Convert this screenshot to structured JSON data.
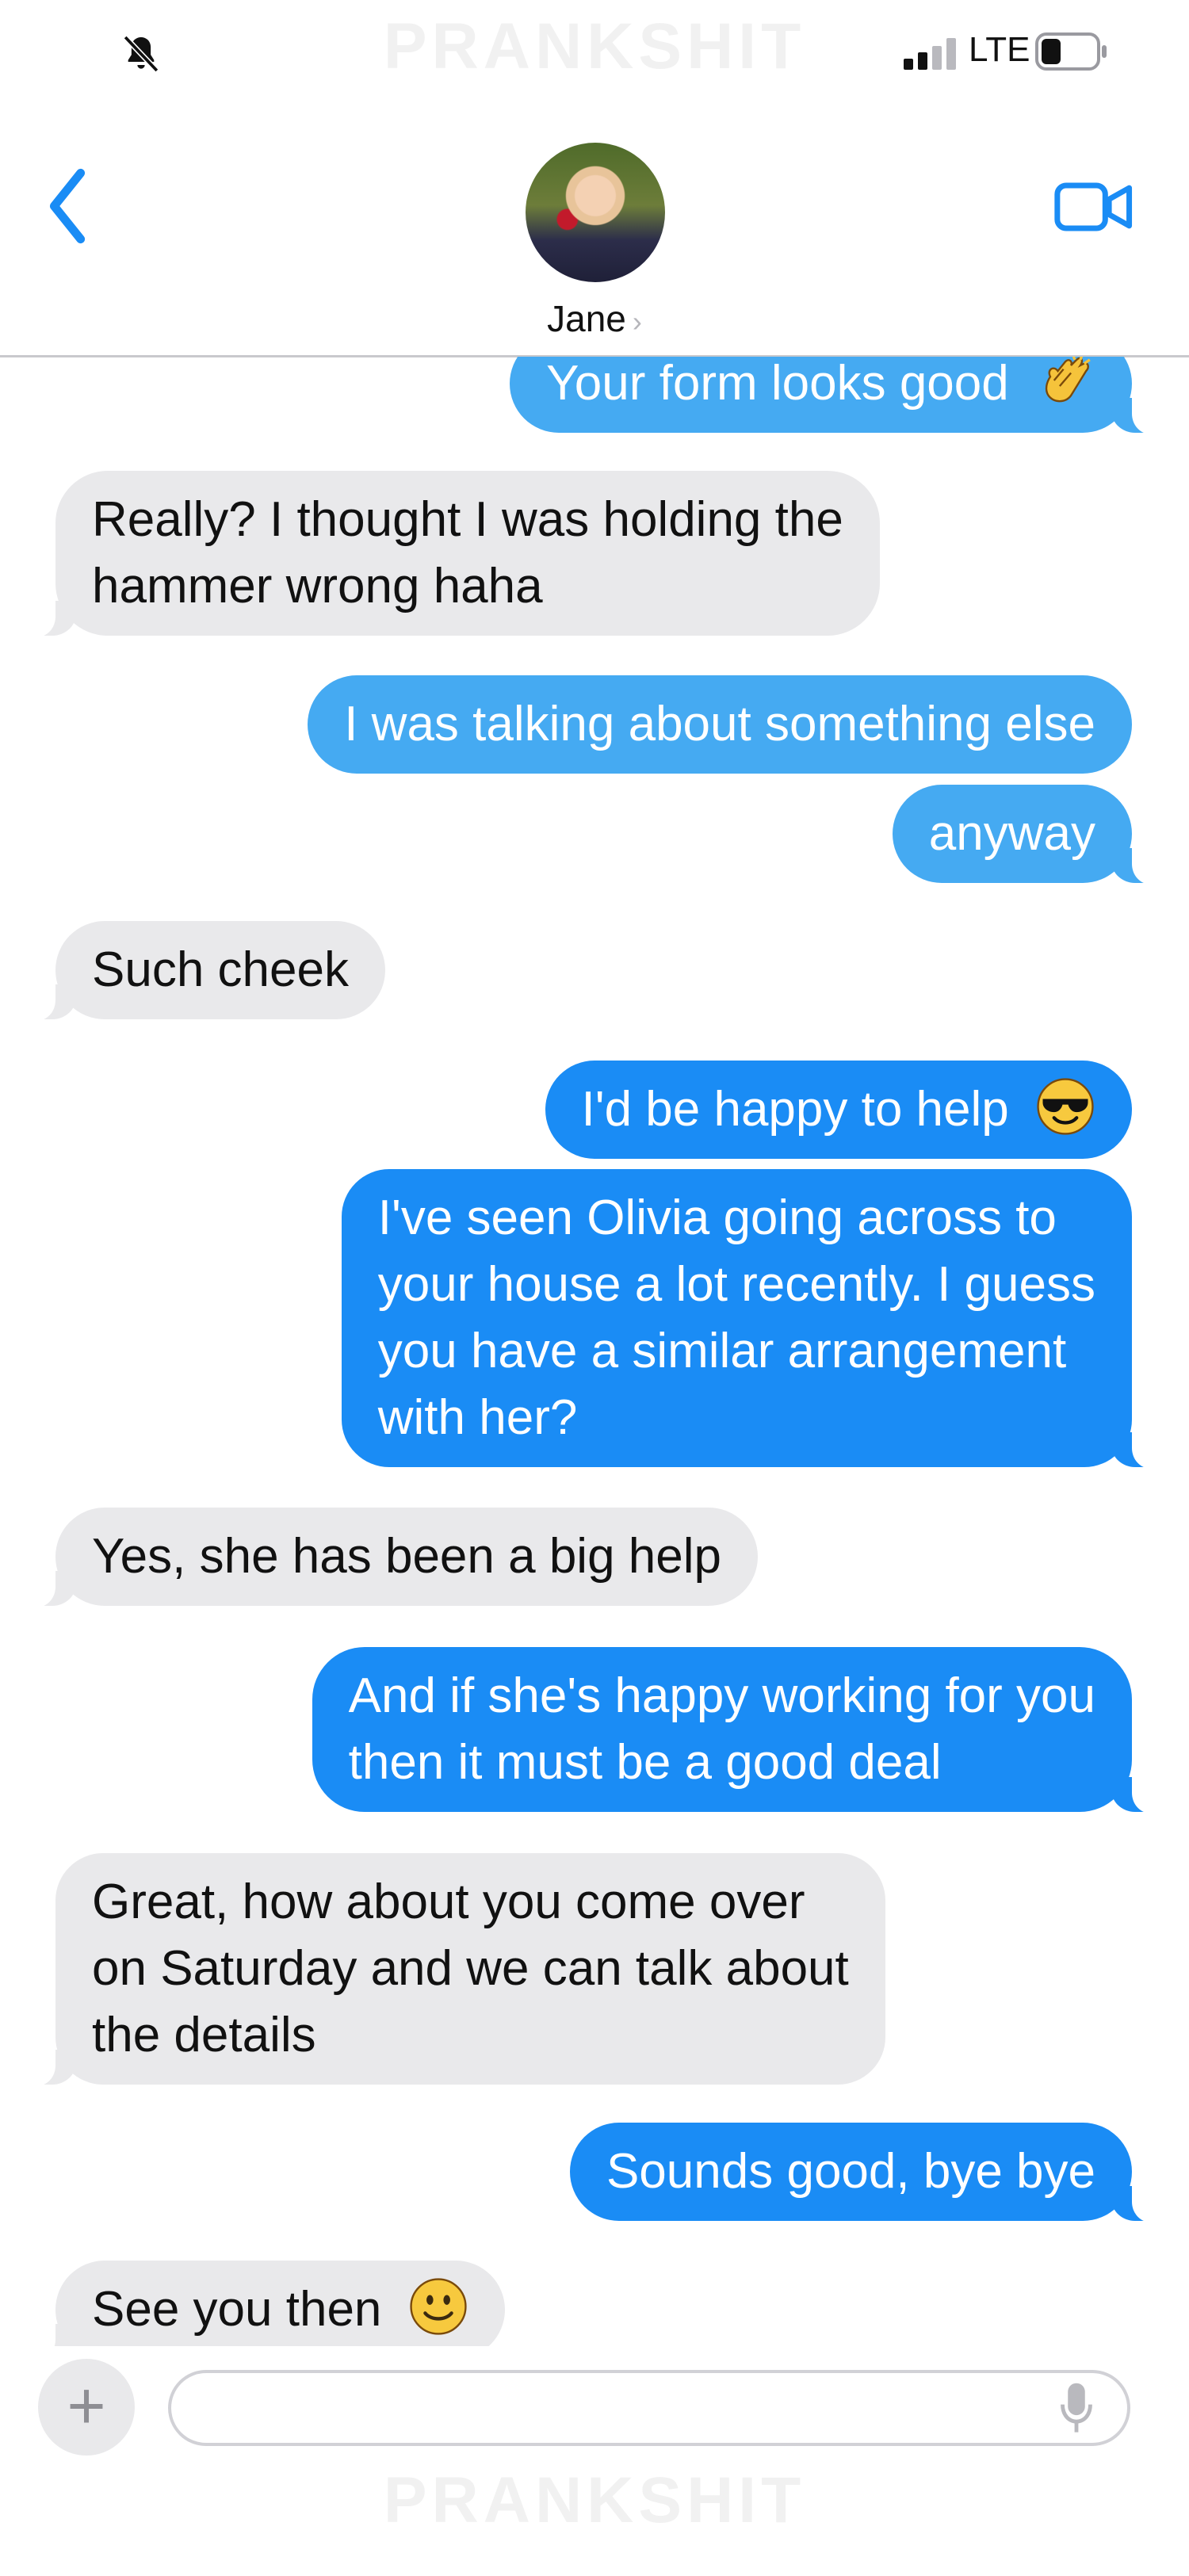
{
  "status_bar": {
    "watermark": "PRANKSHIT",
    "network": "LTE",
    "icons": [
      "bell-slash-icon",
      "signal-icon",
      "battery-icon"
    ]
  },
  "header": {
    "contact_name": "Jane",
    "chevron": "›",
    "icons": [
      "chevron-left-icon",
      "avatar",
      "video-camera-icon"
    ]
  },
  "messages": [
    {
      "side": "out",
      "text": "Your form looks good",
      "emoji": "clapping-hands"
    },
    {
      "side": "in",
      "lines": [
        "Really? I thought I was holding the",
        "hammer wrong haha"
      ]
    },
    {
      "side": "out",
      "text": "I was talking about something else"
    },
    {
      "side": "out",
      "text": "anyway"
    },
    {
      "side": "in",
      "text": "Such cheek"
    },
    {
      "side": "out",
      "text": "I'd be happy to help",
      "emoji": "sunglasses"
    },
    {
      "side": "out",
      "lines": [
        "I've seen Olivia going across to",
        "your house a lot recently. I guess",
        "you have a similar arrangement",
        "with her?"
      ]
    },
    {
      "side": "in",
      "text": "Yes, she has been a big help"
    },
    {
      "side": "out",
      "lines": [
        "And if she's happy working for you",
        "then it must be a good deal"
      ]
    },
    {
      "side": "in",
      "lines": [
        "Great, how about you come over",
        "on Saturday and we can talk about",
        "the details"
      ]
    },
    {
      "side": "out",
      "text": "Sounds good, bye bye"
    },
    {
      "side": "in",
      "text": "See you then",
      "emoji": "slightly-smiling-face"
    }
  ],
  "input_bar": {
    "plus_label": "+",
    "text_value": "",
    "placeholder": "",
    "watermark": "PRANKSHIT"
  },
  "colors": {
    "accent": "#1a8cf5",
    "outgoing_light": "#45aaf2",
    "incoming": "#e9e9eb"
  }
}
